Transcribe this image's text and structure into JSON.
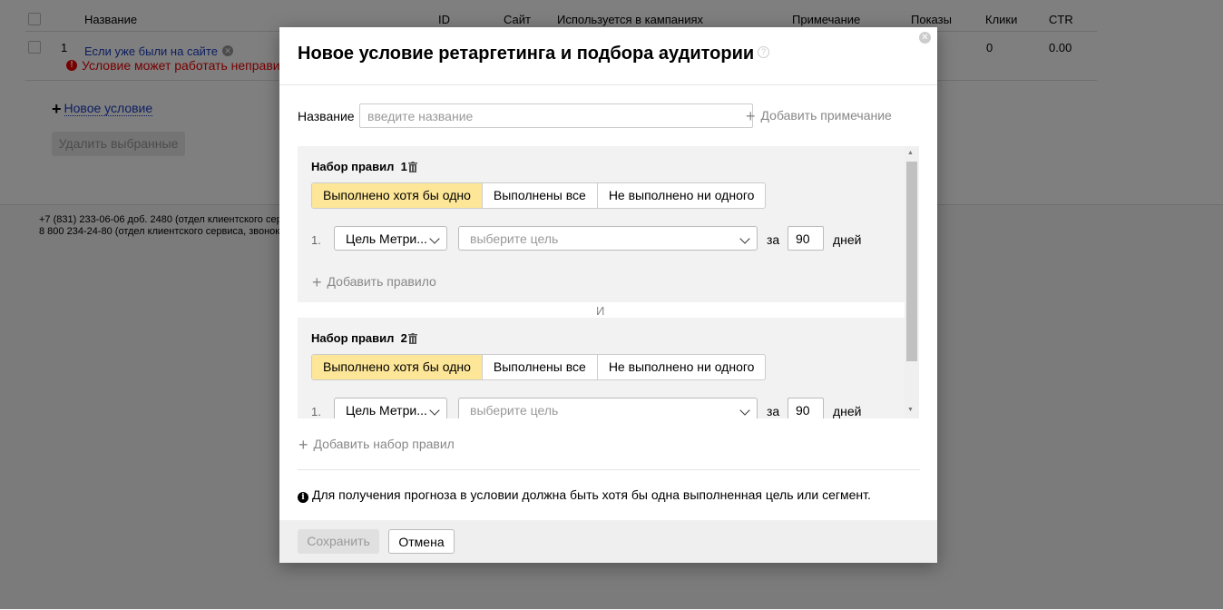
{
  "table": {
    "headers": [
      "Название",
      "ID",
      "Сайт",
      "Используется в кампаниях",
      "Примечание",
      "Показы",
      "Клики",
      "CTR"
    ],
    "row": {
      "num": "1",
      "name": "Если уже были на сайте",
      "warning": "Условие может работать неправиль",
      "clicks": "0",
      "ctr": "0.00"
    }
  },
  "page": {
    "new_condition": "Новое условие",
    "delete_selected": "Удалить выбранные",
    "footer_line1": "+7 (831) 233-06-06 доб. 2480 (отдел клиентского сер",
    "footer_line2": "8 800 234-24-80 (отдел клиентского сервиса, звонок"
  },
  "modal": {
    "title": "Новое условие ретаргетинга и подбора аудитории",
    "name_label": "Название",
    "name_placeholder": "введите название",
    "add_note": "Добавить примечание",
    "and_label": "И",
    "rule_sets": [
      {
        "title": "Набор правил",
        "number": "1",
        "modes": [
          "Выполнено хотя бы одно",
          "Выполнены все",
          "Не выполнено ни одного"
        ],
        "rule_num": "1.",
        "type_select": "Цель Метри...",
        "goal_placeholder": "выберите цель",
        "for_label": "за",
        "days_value": "90",
        "days_label": "дней",
        "add_rule": "Добавить правило"
      },
      {
        "title": "Набор правил",
        "number": "2",
        "modes": [
          "Выполнено хотя бы одно",
          "Выполнены все",
          "Не выполнено ни одного"
        ],
        "rule_num": "1.",
        "type_select": "Цель Метри...",
        "goal_placeholder": "выберите цель",
        "for_label": "за",
        "days_value": "90",
        "days_label": "дней"
      }
    ],
    "add_rule_set": "Добавить набор правил",
    "info": "Для получения прогноза в условии должна быть хотя бы одна выполненная цель или сегмент.",
    "save": "Сохранить",
    "cancel": "Отмена"
  }
}
